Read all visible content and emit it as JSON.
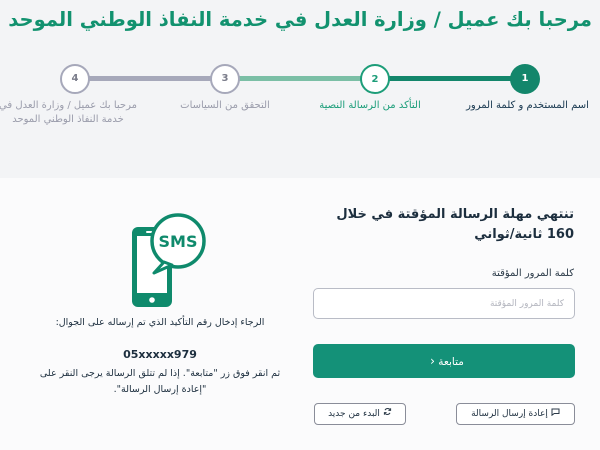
{
  "header": {
    "title": "مرحبا بك عميل / وزارة العدل في خدمة النفاذ الوطني الموحد"
  },
  "stepper": {
    "steps": [
      {
        "number": "1",
        "label": "اسم المستخدم و كلمة المرور",
        "state": "complete"
      },
      {
        "number": "2",
        "label": "التأكد من الرسالة النصية",
        "state": "active"
      },
      {
        "number": "3",
        "label": "التحقق من السياسات",
        "state": "pending"
      },
      {
        "number": "4",
        "label": "مرحبا بك عميل / وزارة العدل في خدمة النفاذ الوطني الموحد",
        "state": "pending"
      }
    ]
  },
  "form": {
    "timer_title": "تنتهي مهلة الرسالة المؤقتة في خلال 160 ثانية/ثواني",
    "otp_label": "كلمة المرور المؤقتة",
    "otp_placeholder": "كلمة المرور المؤقتة",
    "otp_value": "",
    "continue_label": "متابعة",
    "resend_label": "إعادة إرسال الرسالة",
    "restart_label": "البدء من جديد"
  },
  "info": {
    "sms_badge": "SMS",
    "instruction": "الرجاء إدخال رقم التأكيد الذي تم إرساله على الجوال:",
    "phone_number": "05xxxxx979",
    "note": "ثم انقر فوق زر \"متابعة\". إذا لم تتلق الرسالة يرجى النقر على \"إعادة إرسال الرسالة\"."
  },
  "colors": {
    "brand": "#12926f",
    "button": "#149178",
    "pending": "#a6a8ba"
  }
}
